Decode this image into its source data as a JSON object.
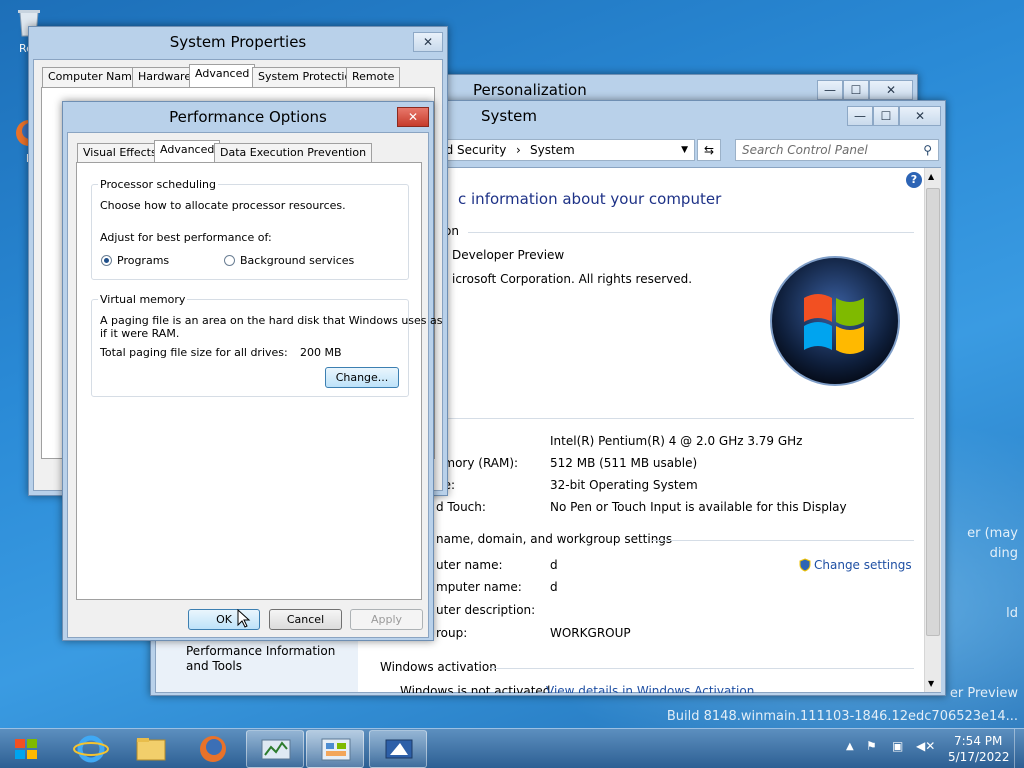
{
  "desktop": {
    "icons": [
      {
        "label": "Rec",
        "icon": "recycle-bin-icon"
      },
      {
        "label": "F",
        "icon": "firefox-icon"
      }
    ],
    "watermark_lines": [
      "er (may",
      "ding",
      "ld",
      "er Preview",
      "Build 8148.winmain.111103-1846.12edc706523e14..."
    ]
  },
  "system_properties": {
    "title": "System Properties",
    "tabs": [
      "Computer Name",
      "Hardware",
      "Advanced",
      "System Protection",
      "Remote"
    ],
    "active_tab": "Advanced",
    "close_glyph": "✕"
  },
  "personalization": {
    "title": "Personalization",
    "min_glyph": "—",
    "max_glyph": "☐",
    "close_glyph": "✕"
  },
  "system": {
    "title": "System",
    "breadcrumb_prefix": "nd Security",
    "breadcrumb_sep": "›",
    "breadcrumb_current": "System",
    "search_placeholder": "Search Control Panel",
    "heading": "c information about your computer",
    "section_edition": "tion",
    "edition": "Developer Preview",
    "copyright": "icrosoft Corporation. All rights reserved.",
    "sidebar_link": "Performance Information and Tools",
    "specs": [
      {
        "label": ":",
        "value": "Intel(R) Pentium(R) 4   @ 2.0 GHz   3.79 GHz"
      },
      {
        "label": "emory (RAM):",
        "value": "512 MB (511 MB usable)"
      },
      {
        "label": "pe:",
        "value": "32-bit Operating System"
      },
      {
        "label": "d Touch:",
        "value": "No Pen or Touch Input is available for this Display"
      }
    ],
    "section_name": "name, domain, and workgroup settings",
    "name_rows": [
      {
        "label": "uter name:",
        "value": "d"
      },
      {
        "label": "mputer name:",
        "value": "d"
      },
      {
        "label": "uter description:",
        "value": ""
      },
      {
        "label": "roup:",
        "value": "WORKGROUP"
      }
    ],
    "change_settings": "Change settings",
    "section_activation": "Windows activation",
    "activation_status": "Windows is not activated",
    "activation_link": "View details in Windows Activation"
  },
  "performance_options": {
    "title": "Performance Options",
    "close_glyph": "✕",
    "tabs": [
      "Visual Effects",
      "Advanced",
      "Data Execution Prevention"
    ],
    "active_tab": "Advanced",
    "processor": {
      "label": "Processor scheduling",
      "desc": "Choose how to allocate processor resources.",
      "adjust": "Adjust for best performance of:",
      "options": [
        "Programs",
        "Background services"
      ],
      "selected": "Programs"
    },
    "virtual_memory": {
      "label": "Virtual memory",
      "desc_line1": "A paging file is an area on the hard disk that Windows uses as",
      "desc_line2": "if it were RAM.",
      "total_label": "Total paging file size for all drives:",
      "total_value": "200 MB",
      "change_button": "Change..."
    },
    "buttons": {
      "ok": "OK",
      "cancel": "Cancel",
      "apply": "Apply"
    }
  },
  "taskbar": {
    "time": "7:54 PM",
    "date": "5/17/2022",
    "apps": [
      "start-icon",
      "internet-explorer-icon",
      "file-explorer-icon",
      "firefox-icon",
      "performance-monitor-icon",
      "control-panel-icon",
      "system-properties-icon"
    ]
  }
}
